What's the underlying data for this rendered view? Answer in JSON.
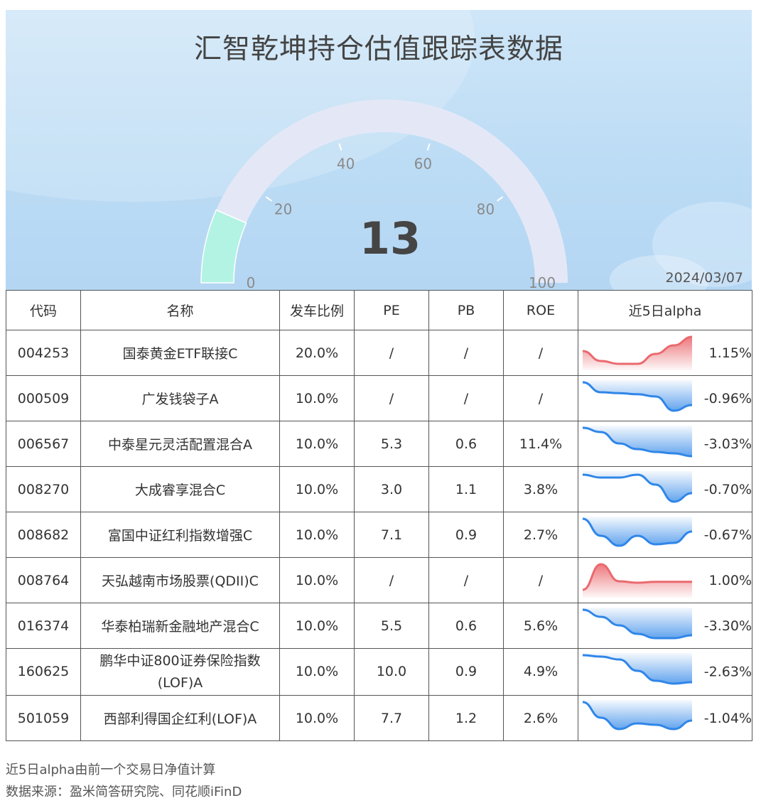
{
  "title": "汇智乾坤持仓估值跟踪表数据",
  "gauge": {
    "value": 13,
    "min": 0,
    "max": 100,
    "ticks": [
      "0",
      "20",
      "40",
      "60",
      "80",
      "100"
    ],
    "value_label": "13",
    "fill_color": "#b3f3e3",
    "track_color": "#e4e8f6"
  },
  "date": "2024/03/07",
  "table": {
    "headers": [
      "代码",
      "名称",
      "发车比例",
      "PE",
      "PB",
      "ROE",
      "近5日alpha"
    ],
    "rows": [
      {
        "code": "004253",
        "name": "国泰黄金ETF联接C",
        "ratio": "20.0%",
        "pe": "/",
        "pb": "/",
        "roe": "/",
        "alpha": "1.15%",
        "spark": [
          0.5,
          0.15,
          0.05,
          0.05,
          0.4,
          0.7,
          1.0
        ]
      },
      {
        "code": "000509",
        "name": "广发钱袋子A",
        "ratio": "10.0%",
        "pe": "/",
        "pb": "/",
        "roe": "/",
        "alpha": "-0.96%",
        "spark": [
          1.0,
          0.65,
          0.62,
          0.58,
          0.5,
          0.0,
          0.2
        ]
      },
      {
        "code": "006567",
        "name": "中泰星元灵活配置混合A",
        "ratio": "10.0%",
        "pe": "5.3",
        "pb": "0.6",
        "roe": "11.4%",
        "alpha": "-3.03%",
        "spark": [
          1.0,
          0.85,
          0.45,
          0.25,
          0.15,
          0.1,
          0.0
        ]
      },
      {
        "code": "008270",
        "name": "大成睿享混合C",
        "ratio": "10.0%",
        "pe": "3.0",
        "pb": "1.1",
        "roe": "3.8%",
        "alpha": "-0.70%",
        "spark": [
          0.95,
          0.85,
          0.85,
          0.95,
          0.6,
          0.0,
          0.3
        ]
      },
      {
        "code": "008682",
        "name": "富国中证红利指数增强C",
        "ratio": "10.0%",
        "pe": "7.1",
        "pb": "0.9",
        "roe": "2.7%",
        "alpha": "-0.67%",
        "spark": [
          1.0,
          0.4,
          0.05,
          0.4,
          0.1,
          0.15,
          0.55
        ]
      },
      {
        "code": "008764",
        "name": "天弘越南市场股票(QDII)C",
        "ratio": "10.0%",
        "pe": "/",
        "pb": "/",
        "roe": "/",
        "alpha": "1.00%",
        "spark": [
          0.1,
          1.0,
          0.4,
          0.35,
          0.38,
          0.38,
          0.38
        ]
      },
      {
        "code": "016374",
        "name": "华泰柏瑞新金融地产混合C",
        "ratio": "10.0%",
        "pe": "5.5",
        "pb": "0.6",
        "roe": "5.6%",
        "alpha": "-3.30%",
        "spark": [
          1.0,
          0.75,
          0.45,
          0.15,
          0.0,
          0.0,
          0.1
        ]
      },
      {
        "code": "160625",
        "name": "鹏华中证800证券保险指数(LOF)A",
        "ratio": "10.0%",
        "pe": "10.0",
        "pb": "0.9",
        "roe": "4.9%",
        "alpha": "-2.63%",
        "spark": [
          1.0,
          0.95,
          0.85,
          0.45,
          0.1,
          0.0,
          0.05
        ]
      },
      {
        "code": "501059",
        "name": "西部利得国企红利(LOF)A",
        "ratio": "10.0%",
        "pe": "7.7",
        "pb": "1.2",
        "roe": "2.6%",
        "alpha": "-1.04%",
        "spark": [
          1.0,
          0.45,
          0.05,
          0.25,
          0.2,
          0.05,
          0.35
        ]
      }
    ]
  },
  "colors": {
    "up": "#ea6a6f",
    "down": "#2f86e8"
  },
  "notes": [
    "近5日alpha由前一个交易日净值计算",
    "数据来源：盈米简答研究院、同花顺iFinD"
  ]
}
